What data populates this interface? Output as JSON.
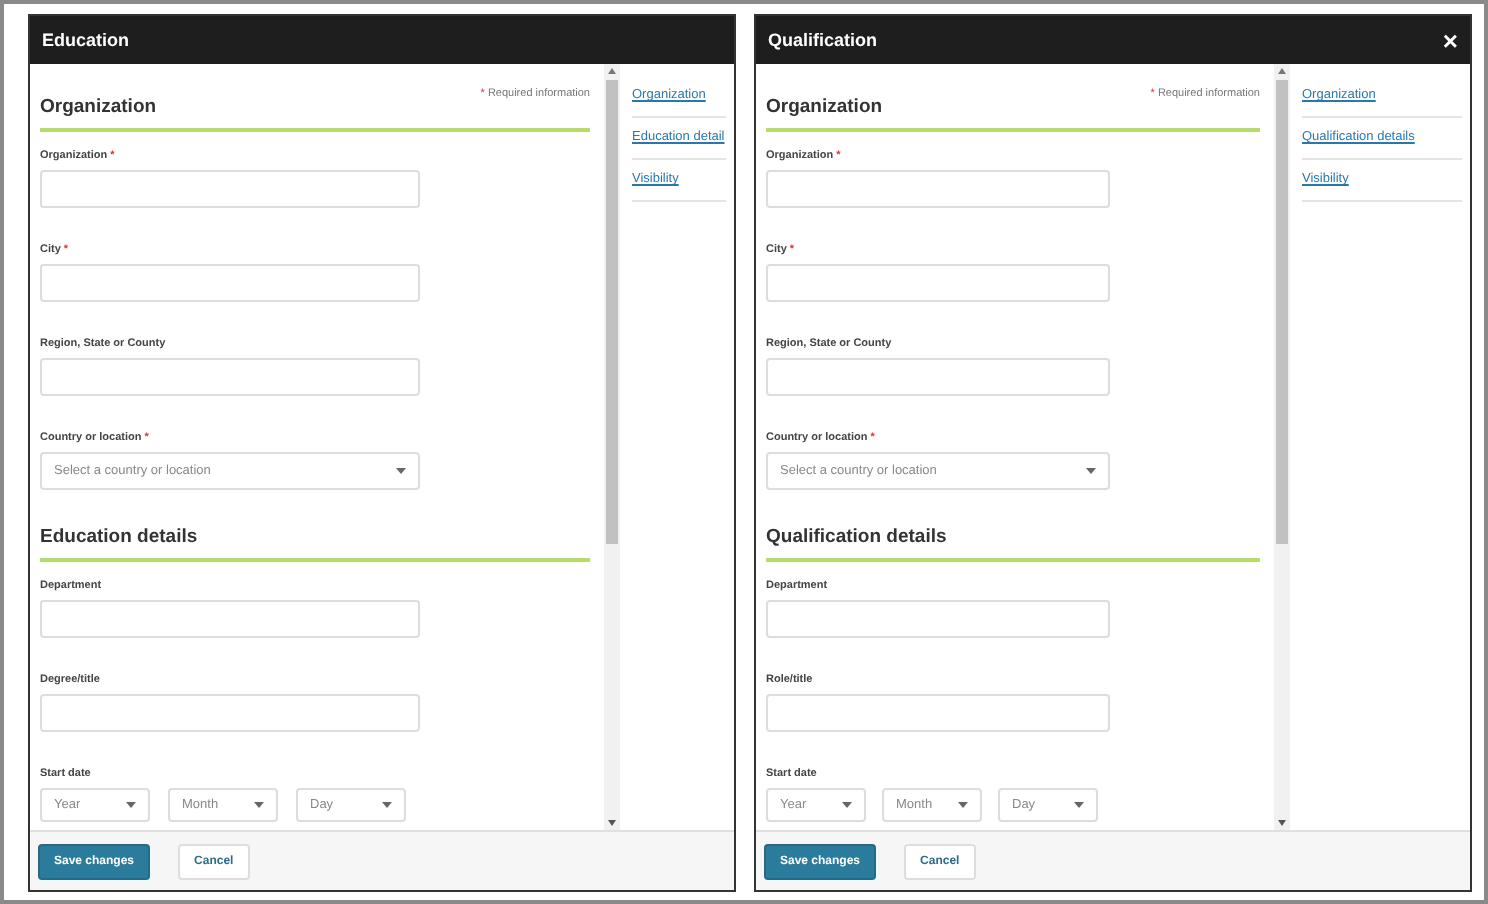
{
  "dialogs": [
    {
      "title": "Education",
      "sections": [
        {
          "heading": "Organization",
          "note_mark": "*",
          "note": "Required information",
          "fields": [
            {
              "kind": "text",
              "label": "Organization",
              "required_mark": "*"
            },
            {
              "kind": "text",
              "label": "City",
              "required_mark": "*"
            },
            {
              "kind": "text",
              "label": "Region, State or County"
            },
            {
              "kind": "select",
              "label": "Country or location",
              "required_mark": "*",
              "placeholder": "Select a country or location"
            }
          ]
        },
        {
          "heading": "Education details",
          "fields": [
            {
              "kind": "text",
              "label": "Department"
            },
            {
              "kind": "text",
              "label": "Degree/title"
            },
            {
              "kind": "date",
              "label": "Start date",
              "parts": [
                "Year",
                "Month",
                "Day"
              ]
            }
          ]
        }
      ],
      "nav": [
        {
          "label": "Organization"
        },
        {
          "label": "Education detail"
        },
        {
          "label": "Visibility"
        }
      ],
      "buttons": [
        {
          "label": "Save changes",
          "kind": "primary"
        },
        {
          "label": "Cancel",
          "kind": "secondary"
        }
      ]
    },
    {
      "title": "Qualification",
      "close_symbol": "×",
      "sections": [
        {
          "heading": "Organization",
          "note_mark": "*",
          "note": "Required information",
          "fields": [
            {
              "kind": "text",
              "label": "Organization",
              "required_mark": "*"
            },
            {
              "kind": "text",
              "label": "City",
              "required_mark": "*"
            },
            {
              "kind": "text",
              "label": "Region, State or County"
            },
            {
              "kind": "select",
              "label": "Country or location",
              "required_mark": "*",
              "placeholder": "Select a country or location"
            }
          ]
        },
        {
          "heading": "Qualification details",
          "fields": [
            {
              "kind": "text",
              "label": "Department"
            },
            {
              "kind": "text",
              "label": "Role/title"
            },
            {
              "kind": "date",
              "label": "Start date",
              "parts": [
                "Year",
                "Month",
                "Day"
              ]
            }
          ]
        }
      ],
      "nav": [
        {
          "label": "Organization"
        },
        {
          "label": "Qualification details"
        },
        {
          "label": "Visibility"
        }
      ],
      "buttons": [
        {
          "label": "Save changes",
          "kind": "primary"
        },
        {
          "label": "Cancel",
          "kind": "secondary"
        }
      ]
    }
  ]
}
